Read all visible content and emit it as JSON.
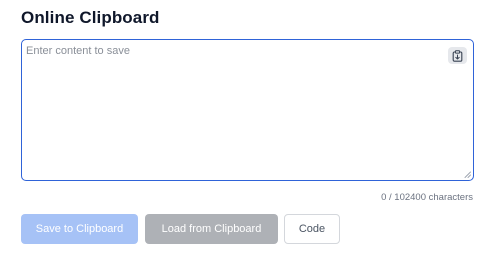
{
  "page": {
    "title": "Online Clipboard"
  },
  "editor": {
    "value": "",
    "placeholder": "Enter content to save",
    "paste_icon": "clipboard-paste-icon"
  },
  "counter": {
    "text": "0 / 102400 characters"
  },
  "actions": {
    "save_label": "Save to Clipboard",
    "load_label": "Load from Clipboard",
    "code_label": "Code"
  },
  "colors": {
    "accent": "#2f63d8",
    "save_disabled_bg": "#a6c2f6",
    "load_disabled_bg": "#aeb1b6"
  }
}
